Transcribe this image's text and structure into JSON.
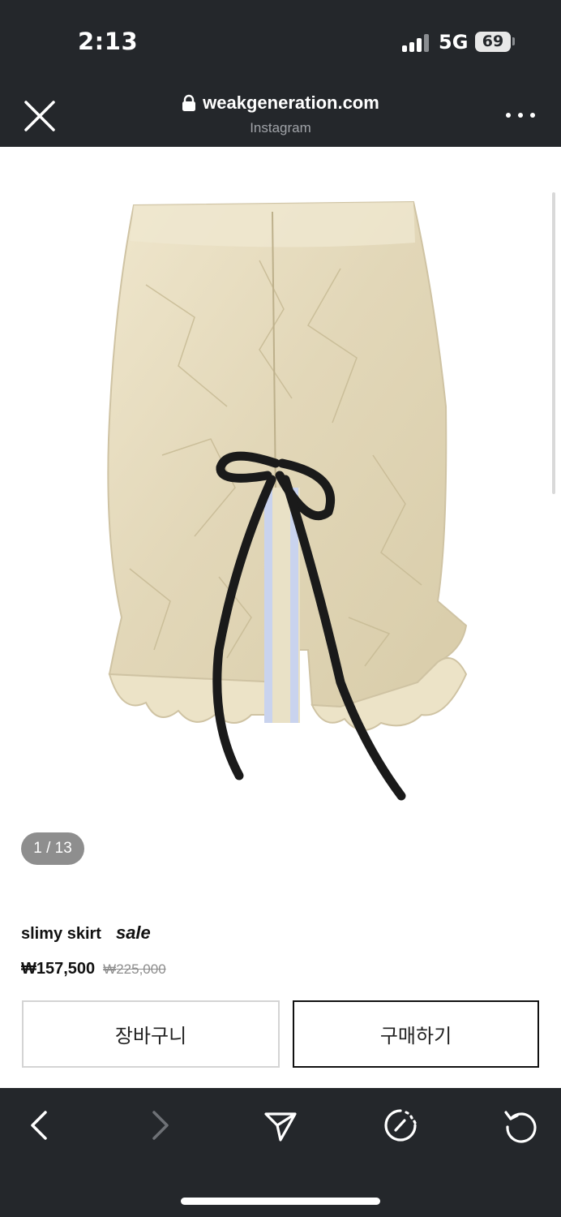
{
  "status_bar": {
    "time": "2:13",
    "network": "5G",
    "battery": "69",
    "signal_bars_active": 3,
    "signal_bars_total": 4
  },
  "browser": {
    "url": "weakgeneration.com",
    "source": "Instagram",
    "close_icon": "close-icon",
    "more_icon": "more-dots-icon",
    "lock_icon": "lock-icon"
  },
  "gallery": {
    "counter": "1 / 13",
    "photo_subject": "cream satin skirt with black ribbon tie",
    "colors": {
      "skirt": "#e6dcc0",
      "ribbon": "#1a1a1a",
      "panel": "#c9d3ee"
    }
  },
  "product": {
    "name": "slimy skirt",
    "tag": "sale",
    "price": "₩157,500",
    "original_price": "₩225,000"
  },
  "actions": {
    "cart_label": "장바구니",
    "buy_label": "구매하기"
  },
  "toolbar": {
    "icons": [
      "back-icon",
      "forward-icon",
      "share-icon",
      "speed-icon",
      "reload-icon"
    ]
  },
  "theme": {
    "chrome_bg": "#24272b",
    "badge_bg": "#8e8e8e"
  }
}
